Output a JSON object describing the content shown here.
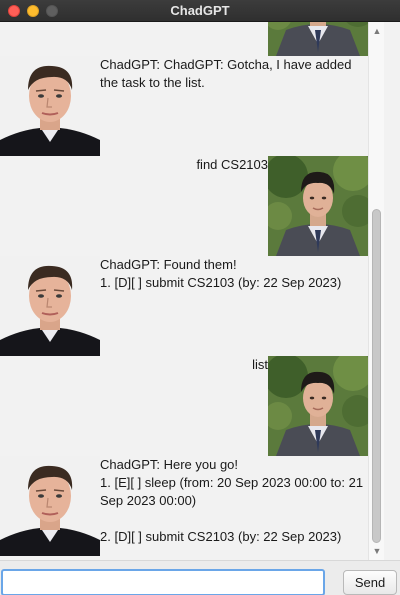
{
  "window": {
    "title": "ChadGPT"
  },
  "messages": [
    {
      "sender": "user",
      "text": ""
    },
    {
      "sender": "bot",
      "text": "ChadGPT: ChadGPT: Gotcha, I have added the task to the list."
    },
    {
      "sender": "user",
      "text": "find CS2103"
    },
    {
      "sender": "bot",
      "text": "ChadGPT: Found them!\n1. [D][ ] submit CS2103 (by: 22 Sep 2023)"
    },
    {
      "sender": "user",
      "text": "list"
    },
    {
      "sender": "bot",
      "text": "ChadGPT: Here you go!\n1. [E][ ] sleep (from: 20 Sep 2023 00:00 to: 21 Sep 2023 00:00)\n\n2. [D][ ] submit CS2103 (by: 22 Sep 2023)"
    }
  ],
  "input": {
    "value": "",
    "placeholder": ""
  },
  "send_button": {
    "label": "Send"
  },
  "colors": {
    "titlebar": "#333333",
    "chat_background": "#f2f2f2",
    "input_focus_ring": "#6aa6e8"
  }
}
